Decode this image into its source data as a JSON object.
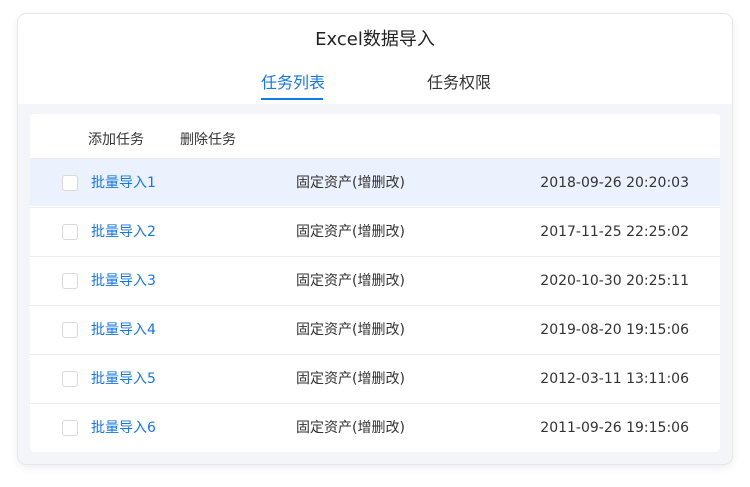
{
  "title": "Excel数据导入",
  "tabs": [
    {
      "label": "任务列表",
      "active": true
    },
    {
      "label": "任务权限",
      "active": false
    }
  ],
  "toolbar": {
    "add_label": "添加任务",
    "delete_label": "删除任务"
  },
  "accent_color": "#1677e6",
  "rows": [
    {
      "name": "批量导入1",
      "type": "固定资产(增删改)",
      "time": "2018-09-26 20:20:03",
      "checked": false
    },
    {
      "name": "批量导入2",
      "type": "固定资产(增删改)",
      "time": "2017-11-25 22:25:02",
      "checked": false
    },
    {
      "name": "批量导入3",
      "type": "固定资产(增删改)",
      "time": "2020-10-30 20:25:11",
      "checked": false
    },
    {
      "name": "批量导入4",
      "type": "固定资产(增删改)",
      "time": "2019-08-20 19:15:06",
      "checked": false
    },
    {
      "name": "批量导入5",
      "type": "固定资产(增删改)",
      "time": "2012-03-11 13:11:06",
      "checked": false
    },
    {
      "name": "批量导入6",
      "type": "固定资产(增删改)",
      "time": "2011-09-26 19:15:06",
      "checked": false
    }
  ]
}
